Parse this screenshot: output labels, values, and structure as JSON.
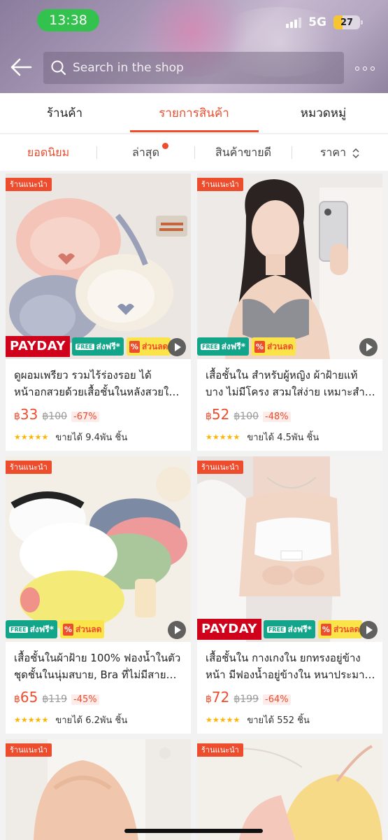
{
  "status_bar": {
    "time": "13:38",
    "network": "5G",
    "battery": "27"
  },
  "header": {
    "search_placeholder": "Search in the shop"
  },
  "tabs": [
    {
      "label": "ร้านค้า"
    },
    {
      "label": "รายการสินค้า"
    },
    {
      "label": "หมวดหมู่"
    }
  ],
  "sort": {
    "popular": "ยอดนิยม",
    "latest": "ล่าสุด",
    "top_sales": "สินค้าขายดี",
    "price": "ราคา"
  },
  "badges": {
    "recommended": "ร้านแนะนำ",
    "payday": "PAYDAY",
    "free_tag": "FREE",
    "free_ship": "ส่งฟรี*",
    "discount_pct": "%",
    "discount": "ส่วนลด"
  },
  "products": [
    {
      "name_line1": "ดูผอมเพรียว รวมไร้ร่องรอย ได้",
      "name_line2": "หน้าอกสวยด้วยเสื้อชั้นในหลังสวยใ…",
      "currency": "฿",
      "price": "33",
      "original_price": "฿100",
      "discount": "-67%",
      "sold": "ขายได้ 9.4พัน ชิ้น",
      "payday": true
    },
    {
      "name_line1": "เสื้อชั้นใน สำหรับผู้หญิง ผ้าฝ้ายแท้",
      "name_line2": "บาง ไม่มีโครง สวมใส่ง่าย เหมาะสำ…",
      "currency": "฿",
      "price": "52",
      "original_price": "฿100",
      "discount": "-48%",
      "sold": "ขายได้ 4.5พัน ชิ้น",
      "payday": false
    },
    {
      "name_line1": "เสื้อชั้นในผ้าฝ้าย 100% ฟองน้ำในตัว",
      "name_line2": "ชุดชั้นในนุ่มสบาย, Bra ที่ไม่มีสาย…",
      "currency": "฿",
      "price": "65",
      "original_price": "฿119",
      "discount": "-45%",
      "sold": "ขายได้ 6.2พัน ชิ้น",
      "payday": false
    },
    {
      "name_line1": "เสื้อชั้นใน กางเกงใน ยกทรงอยู่ข้าง",
      "name_line2": "หน้า มีฟองน้ำอยู่ข้างใน หนาประมา…",
      "currency": "฿",
      "price": "72",
      "original_price": "฿199",
      "discount": "-64%",
      "sold": "ขายได้ 552 ชิ้น",
      "payday": true
    }
  ],
  "colors": {
    "accent": "#ee4d2d",
    "status_green": "#33c24d",
    "free_ship_teal": "#13a58a",
    "discount_yellow": "#fbe34a"
  }
}
